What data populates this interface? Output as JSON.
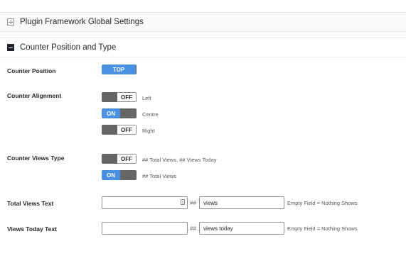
{
  "sections": {
    "global": {
      "title": "Plugin Framework Global Settings",
      "icon": "plus-box-icon"
    },
    "counter": {
      "title": "Counter Position and Type",
      "icon": "minus-box-icon"
    }
  },
  "counter_position": {
    "label": "Counter Position",
    "toggle": "TOP"
  },
  "counter_alignment": {
    "label": "Counter Alignment",
    "options": [
      {
        "state": "OFF",
        "text": "Left"
      },
      {
        "state": "ON",
        "text": "Centre"
      },
      {
        "state": "OFF",
        "text": "Right"
      }
    ]
  },
  "counter_views_type": {
    "label": "Counter Views Type",
    "options": [
      {
        "state": "OFF",
        "text": "## Total Views, ## Views Today"
      },
      {
        "state": "ON",
        "text": "## Total Views"
      }
    ]
  },
  "total_views_text": {
    "label": "Total Views Text",
    "prefix_value": "",
    "hash": "##",
    "suffix_value": "views",
    "note": "Empty Field = Nothing Shows"
  },
  "views_today_text": {
    "label": "Views Today Text",
    "prefix_value": "",
    "hash": "##",
    "suffix_value": "views today",
    "note": "Empty Field = Nothing Shows"
  },
  "colors": {
    "accent": "#4a90e2",
    "toggle_dark": "#666666"
  }
}
